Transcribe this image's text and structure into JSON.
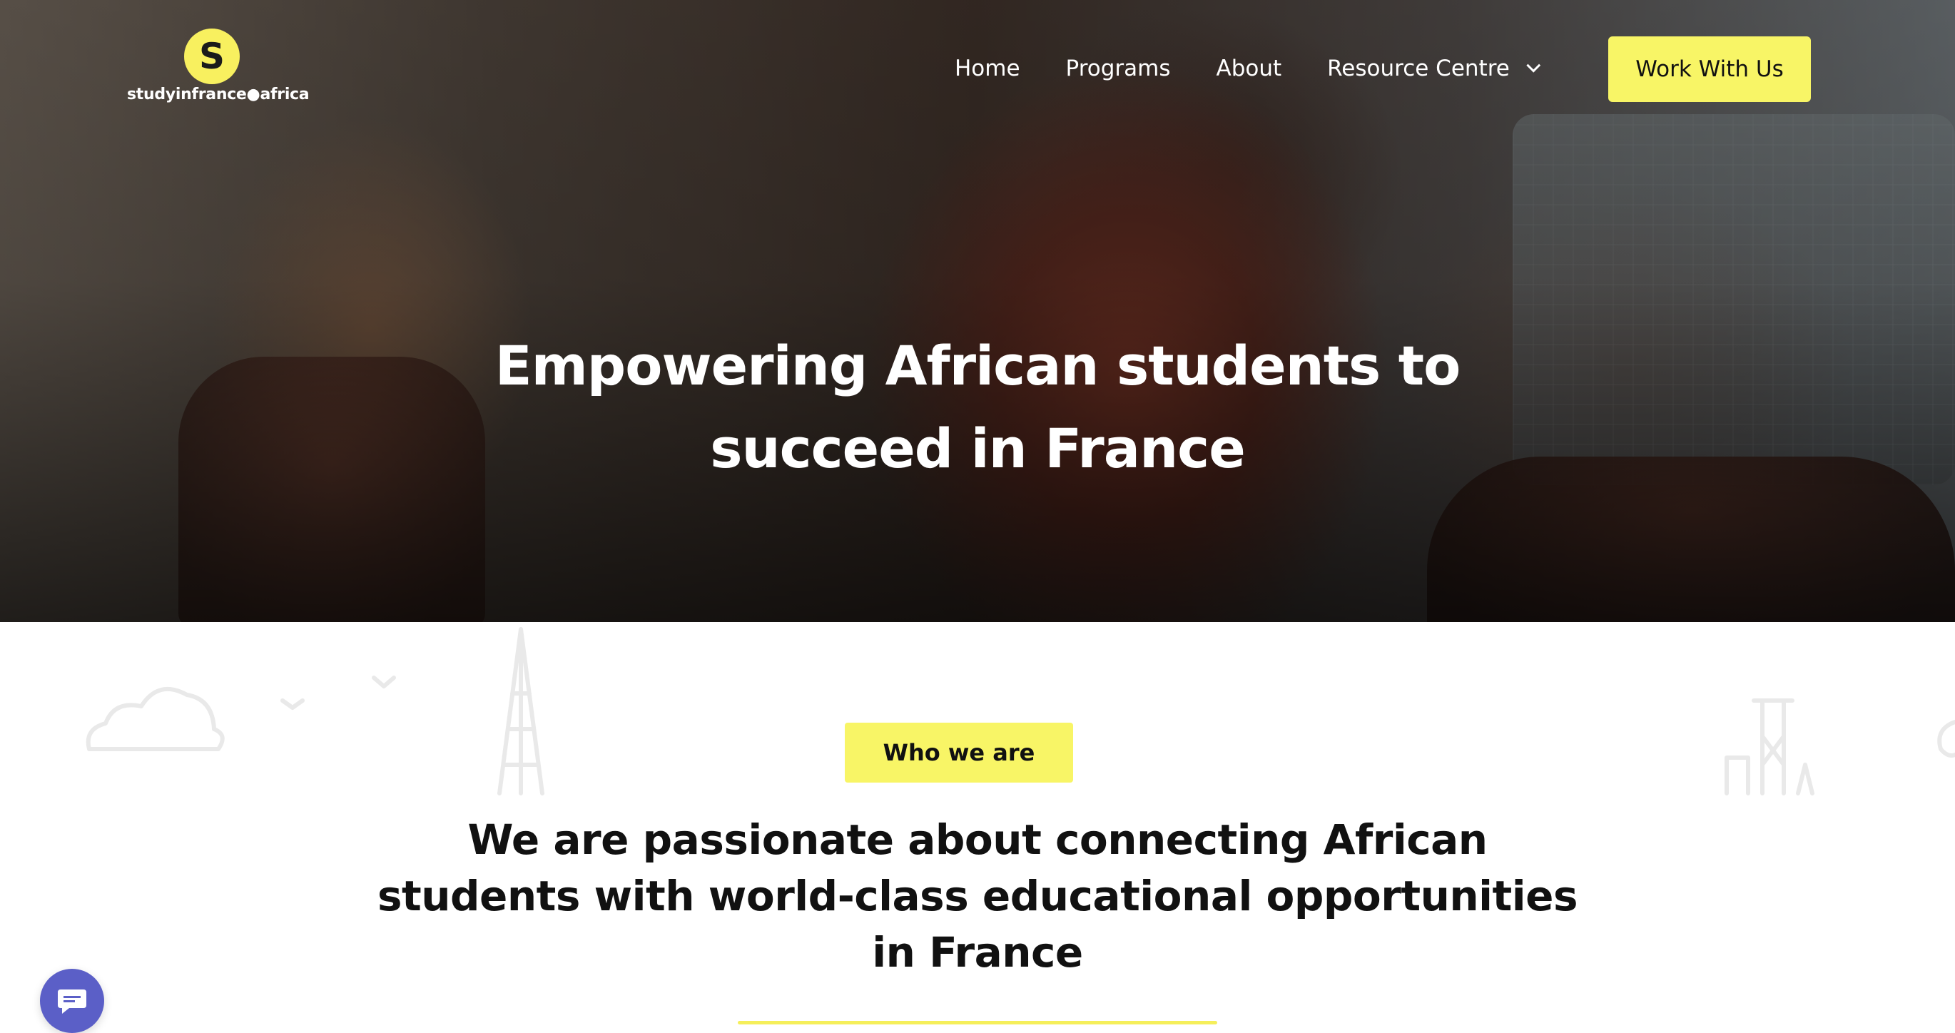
{
  "brand": {
    "logo_letter": "S",
    "logo_text": "studyinfrance●africa",
    "accent_color": "#f8f566"
  },
  "nav": {
    "items": [
      {
        "label": "Home"
      },
      {
        "label": "Programs"
      },
      {
        "label": "About"
      },
      {
        "label": "Resource Centre",
        "has_dropdown": true
      }
    ],
    "cta_label": "Work With Us"
  },
  "hero": {
    "title_line1": "Empowering African students to",
    "title_line2": "succeed in France"
  },
  "section": {
    "badge": "Who we are",
    "heading_line1": "We are passionate about connecting African",
    "heading_line2": "students with world-class educational opportunities",
    "heading_line3": "in France"
  },
  "icons": {
    "chat": "chat-bubble-icon",
    "dropdown": "chevron-down-icon"
  }
}
